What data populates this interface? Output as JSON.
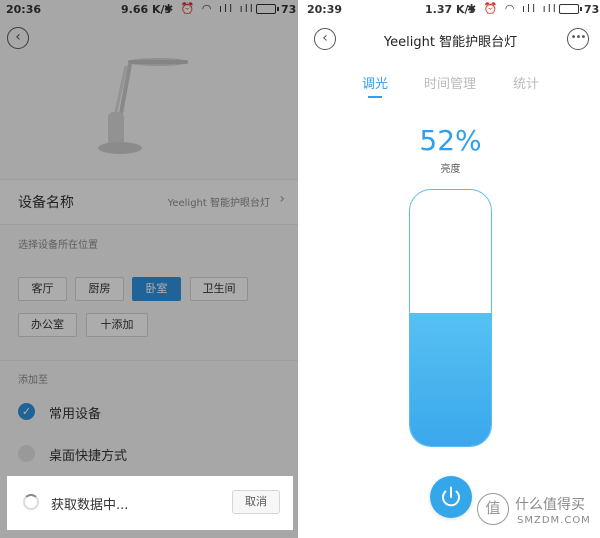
{
  "left": {
    "status": {
      "time": "20:36",
      "rate": "9.66 K/s",
      "signal_icons": "✱ ⏰ ◠ ıll ıll",
      "battery": "73"
    },
    "device_row": {
      "label": "设备名称",
      "value": "Yeelight 智能护眼台灯"
    },
    "location_title": "选择设备所在位置",
    "locations": [
      "客厅",
      "厨房",
      "卧室",
      "卫生间",
      "办公室",
      "十添加"
    ],
    "selected_location": "卧室",
    "add_to_title": "添加至",
    "options": [
      {
        "label": "常用设备",
        "checked": true
      },
      {
        "label": "桌面快捷方式",
        "checked": false
      }
    ],
    "loading": {
      "text": "获取数据中...",
      "cancel": "取消"
    }
  },
  "right": {
    "status": {
      "time": "20:39",
      "rate": "1.37 K/s",
      "signal_icons": "✱ ⏰ ◠ ıll ıll",
      "battery": "73"
    },
    "title": "Yeelight 智能护眼台灯",
    "tabs": [
      {
        "label": "调光",
        "active": true
      },
      {
        "label": "时间管理",
        "active": false
      },
      {
        "label": "统计",
        "active": false
      }
    ],
    "brightness": {
      "value": "52%",
      "label": "亮度",
      "fraction": 0.52
    },
    "watermark": {
      "icon": "值",
      "cn": "什么值得买",
      "en": "SMZDM.COM"
    }
  },
  "colors": {
    "accent": "#2f9ff0",
    "selected": "#2f8fd8",
    "fill": "#45b4ef"
  }
}
